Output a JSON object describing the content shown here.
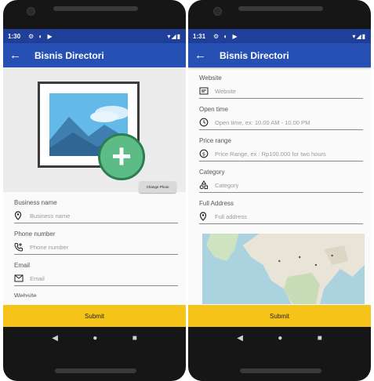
{
  "left": {
    "status": {
      "time": "1:30",
      "icons": "⚙ ◐ ▶",
      "right": "▾◢▮"
    },
    "appbar": {
      "back": "←",
      "title": "Bisnis Directori"
    },
    "change_photo": "Change Photo",
    "fields": [
      {
        "label": "Business name",
        "placeholder": "Business name",
        "icon": "location-pin-icon"
      },
      {
        "label": "Phone number",
        "placeholder": "Phone number",
        "icon": "phone-add-icon"
      },
      {
        "label": "Email",
        "placeholder": "Email",
        "icon": "mail-icon"
      }
    ],
    "cutoff_label": "Website",
    "submit": "Submit"
  },
  "right": {
    "status": {
      "time": "1:31",
      "icons": "⚙ ◐ ▶",
      "right": "▾◢▮"
    },
    "appbar": {
      "back": "←",
      "title": "Bisnis Directori"
    },
    "fields": [
      {
        "label": "Website",
        "placeholder": "Website",
        "icon": "web-icon"
      },
      {
        "label": "Open time",
        "placeholder": "Open time, ex: 10.00 AM - 10.00 PM",
        "icon": "clock-icon"
      },
      {
        "label": "Price range",
        "placeholder": "Price Range, ex : Rp100.000 for two hours",
        "icon": "dollar-icon"
      },
      {
        "label": "Category",
        "placeholder": "Category",
        "icon": "category-icon"
      },
      {
        "label": "Full Address",
        "placeholder": "Full address",
        "icon": "location-pin-icon"
      }
    ],
    "submit": "Submit"
  },
  "nav": {
    "back": "◀",
    "home": "●",
    "recent": "■"
  }
}
